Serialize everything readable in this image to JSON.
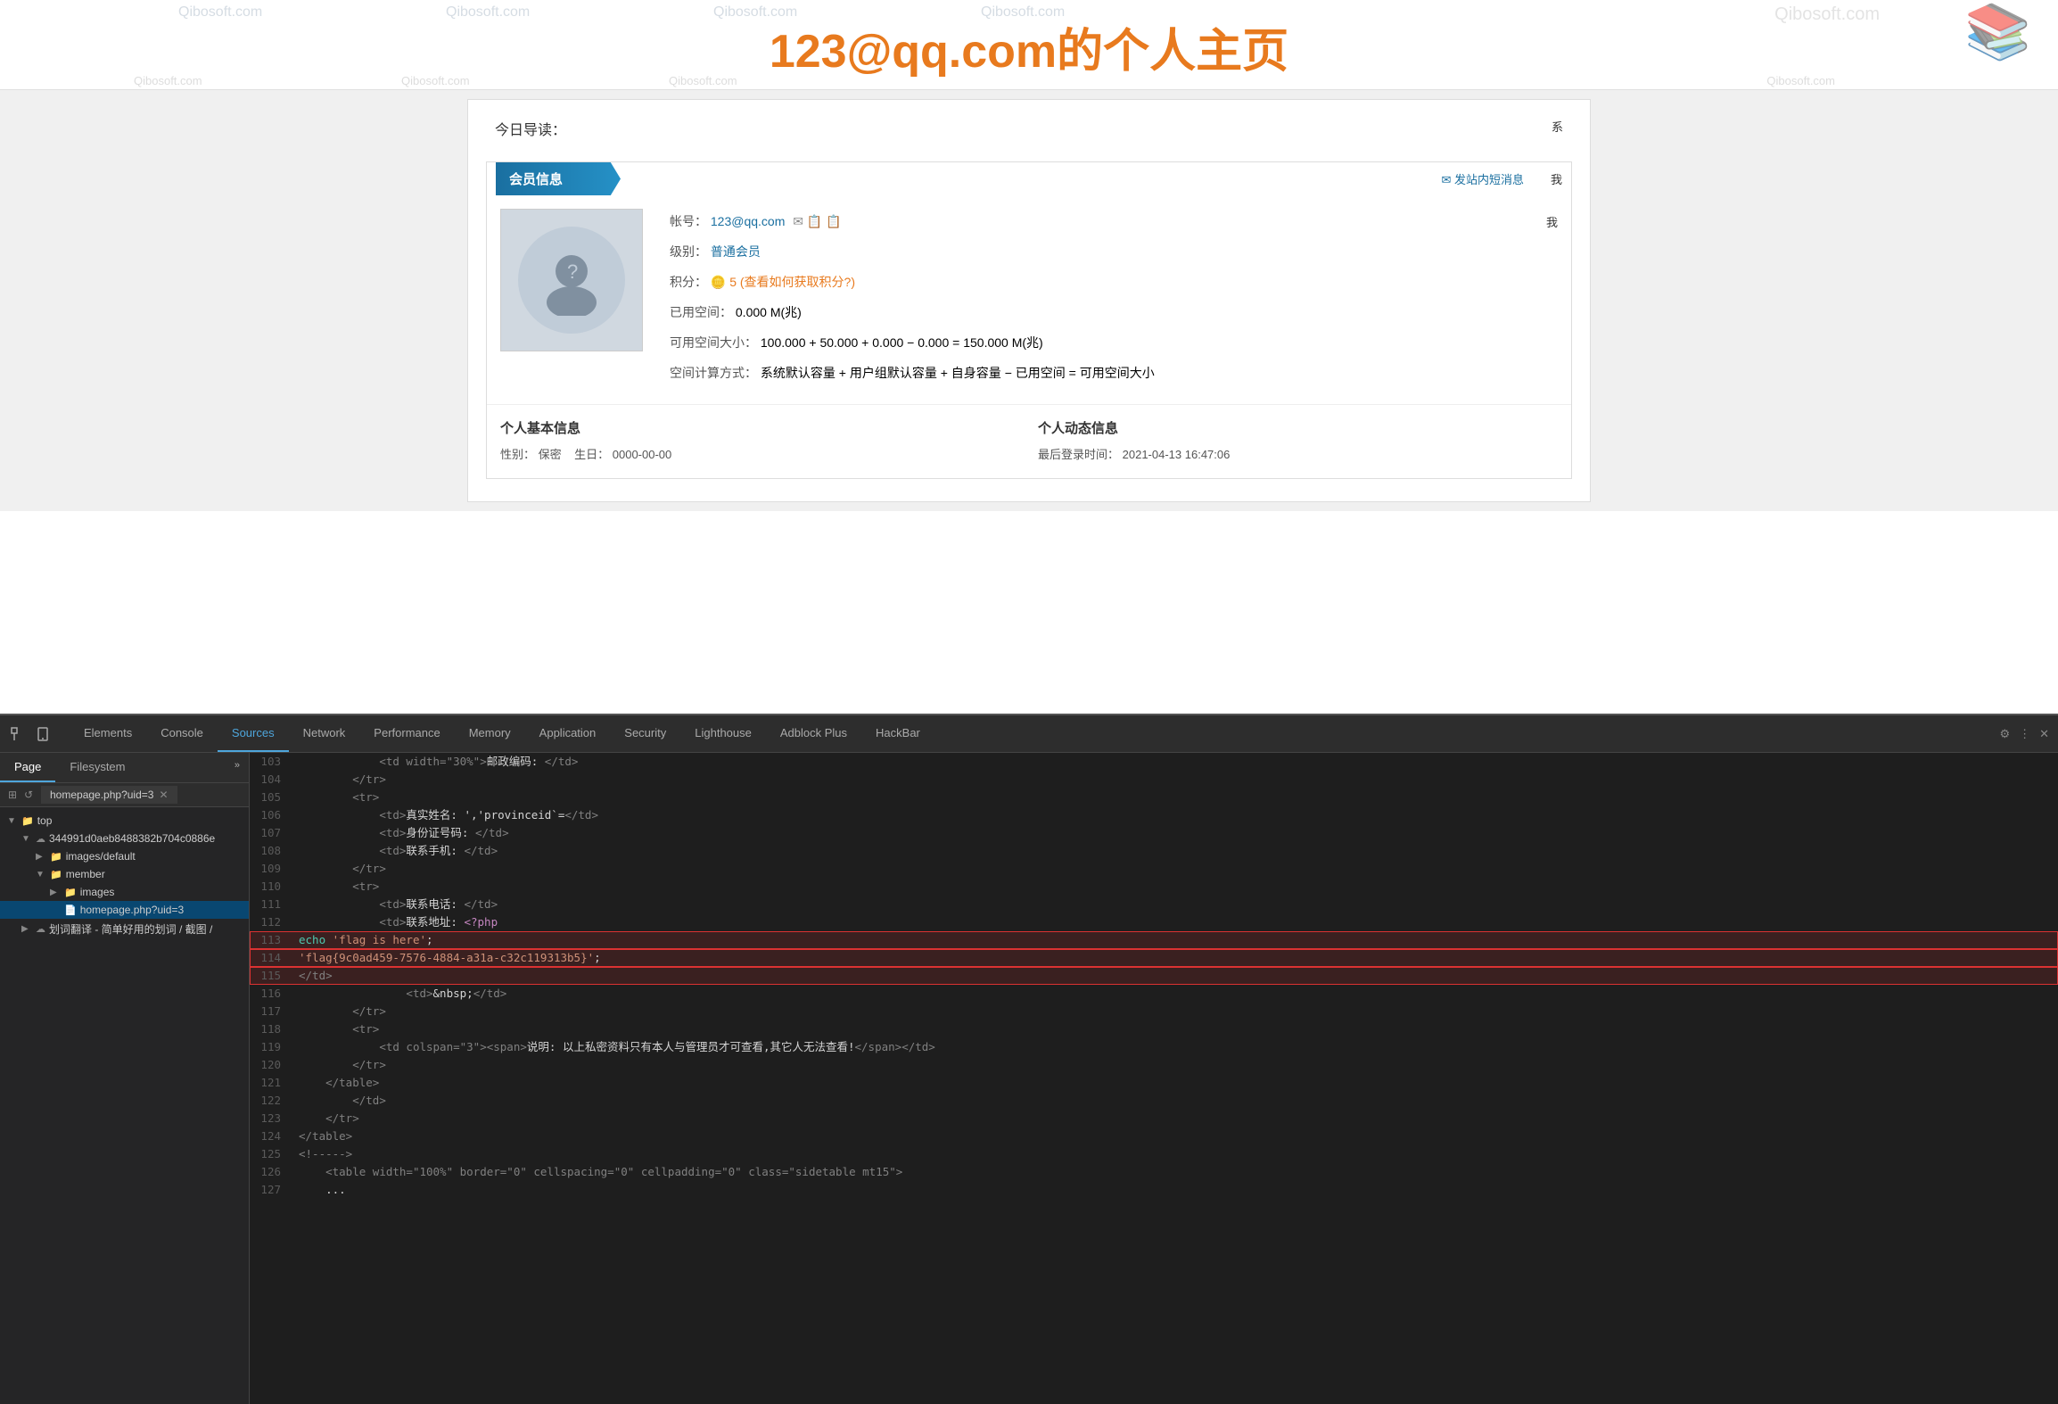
{
  "website": {
    "title": "123@qq.com的个人主页",
    "today_nav": "今日导读：",
    "member_section_title": "会员信息",
    "send_message": "✉ 发站内短消息",
    "account_label": "帐号：",
    "account_value": "123@qq.com",
    "level_label": "级别：",
    "level_value": "普通会员",
    "points_label": "积分：",
    "points_value": "🪙 5 (查看如何获取积分?)",
    "used_space_label": "已用空间：",
    "used_space_value": "0.000 M(兆)",
    "avail_space_label": "可用空间大小：",
    "avail_space_value": "100.000 + 50.000 + 0.000 − 0.000 = 150.000 M(兆)",
    "space_calc_label": "空间计算方式：",
    "space_calc_value": "系统默认容量 + 用户组默认容量 + 自身容量 − 已用空间 = 可用空间大小",
    "personal_basic_title": "个人基本信息",
    "gender_label": "性别：",
    "gender_value": "保密",
    "birthday_label": "生日：",
    "birthday_value": "0000-00-00",
    "personal_dynamic_title": "个人动态信息",
    "last_login_label": "最后登录时间：",
    "last_login_value": "2021-04-13 16:47:06"
  },
  "devtools": {
    "tabs": [
      {
        "id": "elements",
        "label": "Elements"
      },
      {
        "id": "console",
        "label": "Console"
      },
      {
        "id": "sources",
        "label": "Sources",
        "active": true
      },
      {
        "id": "network",
        "label": "Network"
      },
      {
        "id": "performance",
        "label": "Performance"
      },
      {
        "id": "memory",
        "label": "Memory"
      },
      {
        "id": "application",
        "label": "Application"
      },
      {
        "id": "security",
        "label": "Security"
      },
      {
        "id": "lighthouse",
        "label": "Lighthouse"
      },
      {
        "id": "adblock",
        "label": "Adblock Plus"
      },
      {
        "id": "hackbar",
        "label": "HackBar"
      }
    ],
    "left_tabs": [
      {
        "id": "page",
        "label": "Page",
        "active": true
      },
      {
        "id": "filesystem",
        "label": "Filesystem"
      }
    ],
    "file_open": "homepage.php?uid=3",
    "tree": [
      {
        "id": "top",
        "label": "top",
        "indent": 0,
        "type": "folder",
        "expanded": true,
        "active": false
      },
      {
        "id": "domain",
        "label": "344991d0aeb8488382b704c0886e",
        "indent": 1,
        "type": "cloud",
        "expanded": true
      },
      {
        "id": "images-default",
        "label": "images/default",
        "indent": 2,
        "type": "folder",
        "expanded": false
      },
      {
        "id": "member",
        "label": "member",
        "indent": 2,
        "type": "folder",
        "expanded": true
      },
      {
        "id": "images",
        "label": "images",
        "indent": 3,
        "type": "folder",
        "expanded": false
      },
      {
        "id": "homepage",
        "label": "homepage.php?uid=3",
        "indent": 3,
        "type": "file",
        "active": true
      },
      {
        "id": "trans",
        "label": "划词翻译 - 简单好用的划词 / 截图 /",
        "indent": 1,
        "type": "cloud",
        "expanded": false
      }
    ],
    "code_lines": [
      {
        "num": 103,
        "content": "            <td width=\"30%\">邮政编码: </td>",
        "highlight": false
      },
      {
        "num": 104,
        "content": "        </tr>",
        "highlight": false
      },
      {
        "num": 105,
        "content": "        <tr>",
        "highlight": false
      },
      {
        "num": 106,
        "content": "            <td>真实姓名: ','provinceid`=</td>",
        "highlight": false
      },
      {
        "num": 107,
        "content": "            <td>身份证号码: </td>",
        "highlight": false
      },
      {
        "num": 108,
        "content": "            <td>联系手机: </td>",
        "highlight": false
      },
      {
        "num": 109,
        "content": "        </tr>",
        "highlight": false
      },
      {
        "num": 110,
        "content": "        <tr>",
        "highlight": false
      },
      {
        "num": 111,
        "content": "            <td>联系电话: </td>",
        "highlight": false
      },
      {
        "num": 112,
        "content": "            <td>联系地址: <?php",
        "highlight": false
      },
      {
        "num": 113,
        "content": "echo 'flag is here';",
        "highlight": true
      },
      {
        "num": 114,
        "content": "'flag{9c0ad459-7576-4884-a31a-c32c119313b5}';",
        "highlight": true
      },
      {
        "num": 115,
        "content": "</td>",
        "highlight": true
      },
      {
        "num": 116,
        "content": "                <td>&nbsp;</td>",
        "highlight": false
      },
      {
        "num": 117,
        "content": "        </tr>",
        "highlight": false
      },
      {
        "num": 118,
        "content": "        <tr>",
        "highlight": false
      },
      {
        "num": 119,
        "content": "            <td colspan=\"3\"><span>说明: 以上私密资料只有本人与管理员才可查看,其它人无法查看!</span></td>",
        "highlight": false
      },
      {
        "num": 120,
        "content": "        </tr>",
        "highlight": false
      },
      {
        "num": 121,
        "content": "    </table>",
        "highlight": false
      },
      {
        "num": 122,
        "content": "        </td>",
        "highlight": false
      },
      {
        "num": 123,
        "content": "    </tr>",
        "highlight": false
      },
      {
        "num": 124,
        "content": "</table>",
        "highlight": false
      },
      {
        "num": 125,
        "content": "<!----->",
        "highlight": false
      },
      {
        "num": 126,
        "content": "    <table width=\"100%\" border=\"0\" cellspacing=\"0\" cellpadding=\"0\" class=\"sidetable mt15\">",
        "highlight": false
      },
      {
        "num": 127,
        "content": "    ...",
        "highlight": false
      }
    ]
  }
}
